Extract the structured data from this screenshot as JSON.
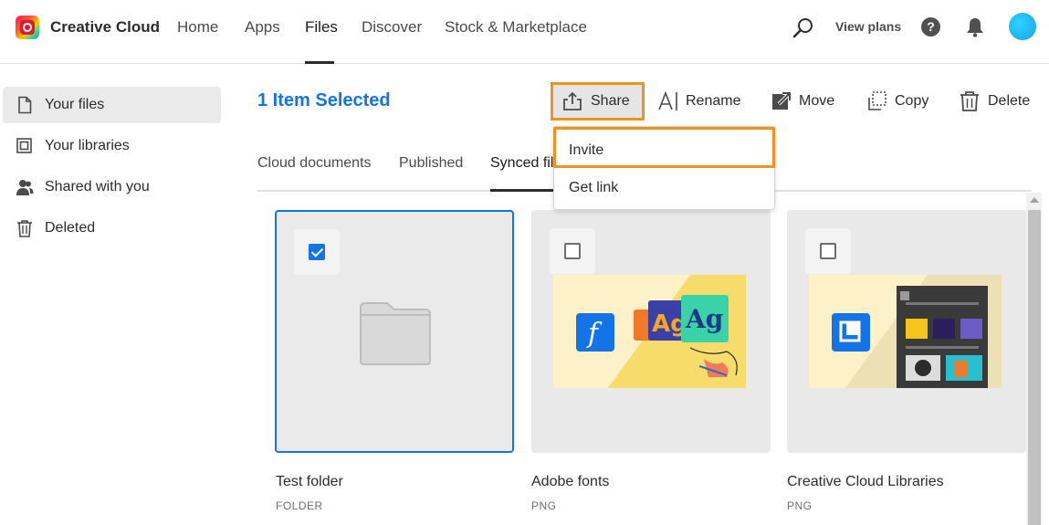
{
  "app": {
    "brand": "Creative Cloud"
  },
  "nav": {
    "items": [
      {
        "label": "Home"
      },
      {
        "label": "Apps"
      },
      {
        "label": "Files"
      },
      {
        "label": "Discover"
      },
      {
        "label": "Stock & Marketplace"
      }
    ],
    "active": "Files",
    "view_plans": "View plans"
  },
  "sidebar": {
    "items": [
      {
        "label": "Your files",
        "icon": "file-icon",
        "active": true
      },
      {
        "label": "Your libraries",
        "icon": "libraries-icon"
      },
      {
        "label": "Shared with you",
        "icon": "people-icon"
      },
      {
        "label": "Deleted",
        "icon": "trash-icon"
      }
    ]
  },
  "header": {
    "title": "1 Item Selected"
  },
  "actions": {
    "share": "Share",
    "rename": "Rename",
    "move": "Move",
    "copy": "Copy",
    "delete": "Delete"
  },
  "tabs": [
    {
      "label": "Cloud documents"
    },
    {
      "label": "Published"
    },
    {
      "label": "Synced files",
      "active": true
    }
  ],
  "share_menu": {
    "items": [
      {
        "label": "Invite"
      },
      {
        "label": "Get link"
      }
    ]
  },
  "cards": [
    {
      "name": "Test folder",
      "type": "FOLDER",
      "checked": true
    },
    {
      "name": "Adobe fonts",
      "type": "PNG",
      "checked": false
    },
    {
      "name": "Creative Cloud Libraries",
      "type": "PNG",
      "checked": false
    }
  ],
  "colors": {
    "accent": "#1473e6",
    "highlight": "#f0921e"
  }
}
